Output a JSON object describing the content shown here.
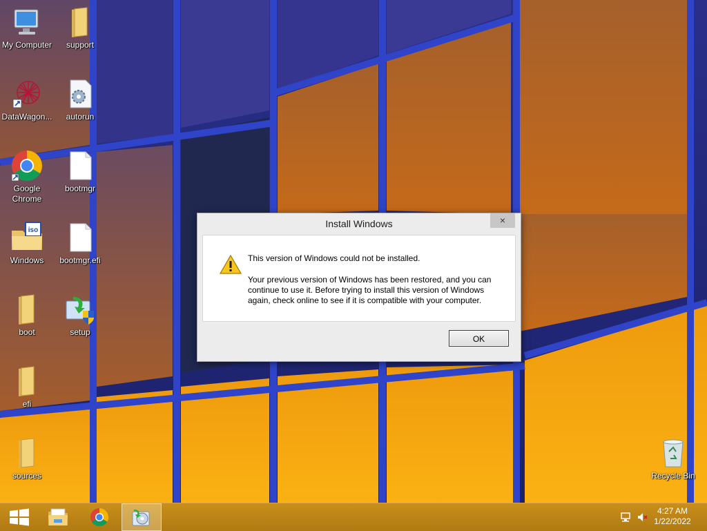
{
  "desktop": {
    "icons": [
      {
        "label": "My Computer",
        "icon": "computer-icon"
      },
      {
        "label": "support",
        "icon": "folder-icon"
      },
      {
        "label": "DataWagon...",
        "icon": "datawagon-icon"
      },
      {
        "label": "autorun",
        "icon": "settings-file-icon"
      },
      {
        "label": "Google Chrome",
        "icon": "chrome-icon"
      },
      {
        "label": "bootmgr",
        "icon": "file-icon"
      },
      {
        "label": "Windows",
        "icon": "iso-folder-icon"
      },
      {
        "label": "bootmgr.efi",
        "icon": "file-icon"
      },
      {
        "label": "boot",
        "icon": "folder-icon"
      },
      {
        "label": "setup",
        "icon": "setup-icon"
      },
      {
        "label": "efi",
        "icon": "folder-icon"
      },
      {
        "label": "sources",
        "icon": "folder-icon"
      },
      {
        "label": "Recycle Bin",
        "icon": "recycle-bin-icon"
      }
    ]
  },
  "dialog": {
    "title": "Install Windows",
    "close_label": "×",
    "message_main": "This version of Windows could not be installed.",
    "message_detail": "Your previous version of Windows has been restored, and you can continue to use it.  Before trying to install this version of Windows again, check online to see if it is compatible with your computer.",
    "ok_label": "OK",
    "icon": "warning-icon"
  },
  "taskbar": {
    "buttons": [
      {
        "icon": "windows-start-icon"
      },
      {
        "icon": "file-explorer-icon"
      },
      {
        "icon": "chrome-icon"
      },
      {
        "icon": "setup-disc-icon",
        "active": true
      }
    ],
    "tray": [
      {
        "icon": "network-icon"
      },
      {
        "icon": "volume-muted-icon"
      }
    ],
    "time": "4:27 AM",
    "date": "1/22/2022"
  },
  "colors": {
    "taskbar": "#c08516",
    "window_frame": "#2b3fb8",
    "glass_orange": "#f5a20a",
    "dialog_bg": "#ececec"
  }
}
